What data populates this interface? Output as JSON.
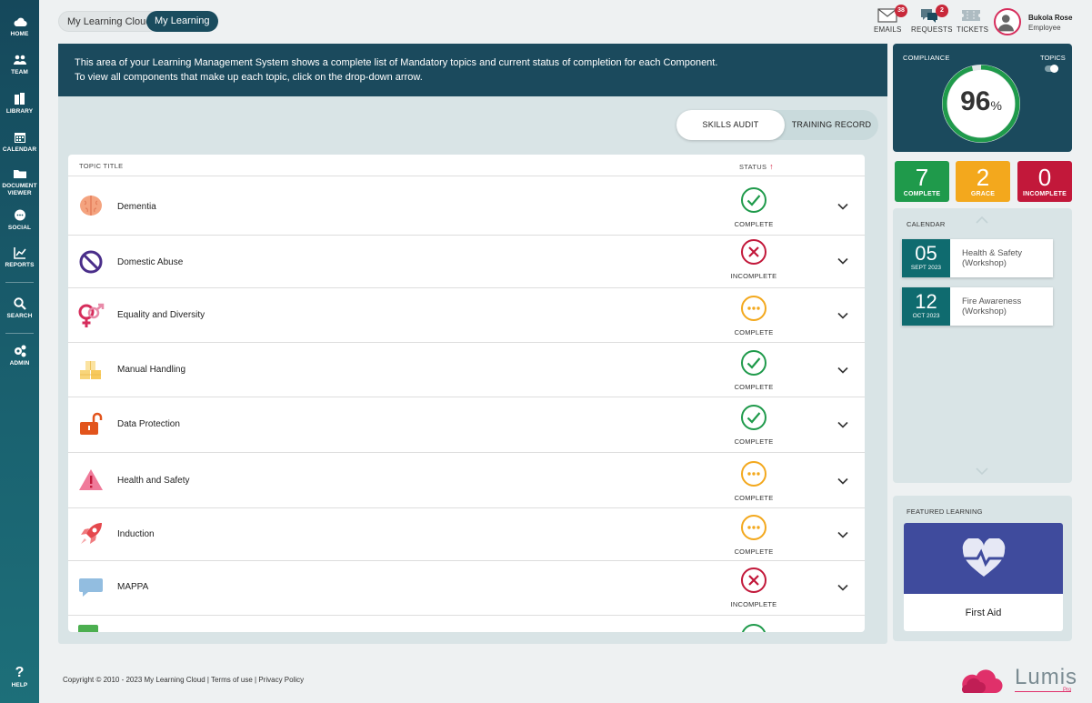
{
  "sidebar": {
    "items": [
      {
        "label": "HOME",
        "icon": "cloud-icon"
      },
      {
        "label": "TEAM",
        "icon": "team-icon"
      },
      {
        "label": "LIBRARY",
        "icon": "books-icon"
      },
      {
        "label": "CALENDAR",
        "icon": "calendar-icon"
      },
      {
        "label": "DOCUMENT",
        "label2": "VIEWER",
        "icon": "folder-icon"
      },
      {
        "label": "SOCIAL",
        "icon": "chat-icon"
      },
      {
        "label": "REPORTS",
        "icon": "chart-icon"
      },
      {
        "label": "SEARCH",
        "icon": "search-icon"
      },
      {
        "label": "ADMIN",
        "icon": "gears-icon"
      },
      {
        "label": "HELP",
        "icon": "help-icon"
      }
    ]
  },
  "breadcrumb": [
    "My Learning Cloud",
    "My Learning"
  ],
  "header": {
    "emails": {
      "label": "EMAILS",
      "count": "38"
    },
    "requests": {
      "label": "REQUESTS",
      "count": "2"
    },
    "tickets": {
      "label": "TICKETS"
    },
    "user": {
      "name": "Bukola Rose",
      "role": "Employee"
    }
  },
  "banner": {
    "line1": "This area of your Learning Management System shows a complete list of Mandatory topics and current status of completion for each Component.",
    "line2": "To view all components that make up each topic, click on the drop-down arrow."
  },
  "view_toggle": {
    "active": "SKILLS AUDIT",
    "inactive": "TRAINING RECORD"
  },
  "table": {
    "headers": {
      "title": "TOPIC TITLE",
      "status": "STATUS"
    },
    "rows": [
      {
        "title": "Dementia",
        "status": "COMPLETE",
        "state": "complete",
        "icon": "brain-icon"
      },
      {
        "title": "Domestic Abuse",
        "status": "INCOMPLETE",
        "state": "incomplete",
        "icon": "prohibited-icon"
      },
      {
        "title": "Equality and Diversity",
        "status": "COMPLETE",
        "state": "grace",
        "icon": "gender-icon"
      },
      {
        "title": "Manual Handling",
        "status": "COMPLETE",
        "state": "complete",
        "icon": "boxes-icon"
      },
      {
        "title": "Data Protection",
        "status": "COMPLETE",
        "state": "complete",
        "icon": "padlock-icon"
      },
      {
        "title": "Health and Safety",
        "status": "COMPLETE",
        "state": "grace",
        "icon": "warning-icon"
      },
      {
        "title": "Induction",
        "status": "COMPLETE",
        "state": "grace",
        "icon": "rocket-icon"
      },
      {
        "title": "MAPPA",
        "status": "INCOMPLETE",
        "state": "incomplete",
        "icon": "speech-bubble-icon"
      }
    ]
  },
  "compliance": {
    "label": "COMPLIANCE",
    "topics_label": "TOPICS",
    "value": "96",
    "unit": "%",
    "fraction": 0.96
  },
  "stats": [
    {
      "value": "7",
      "label": "COMPLETE",
      "color": "#1f9a4b"
    },
    {
      "value": "2",
      "label": "GRACE",
      "color": "#f3a81d"
    },
    {
      "value": "0",
      "label": "INCOMPLETE",
      "color": "#c2183a"
    }
  ],
  "calendar": {
    "label": "CALENDAR",
    "events": [
      {
        "day": "05",
        "month": "SEPT 2023",
        "title": "Health & Safety",
        "subtitle": "(Workshop)"
      },
      {
        "day": "12",
        "month": "OCT 2023",
        "title": "Fire Awareness",
        "subtitle": "(Workshop)"
      }
    ]
  },
  "featured": {
    "label": "FEATURED LEARNING",
    "title": "First Aid"
  },
  "footer": {
    "text": "Copyright © 2010 - 2023 My Learning Cloud | Terms of use | Privacy Policy"
  },
  "logo": {
    "name": "Lumis",
    "sub": "Pro"
  },
  "colors": {
    "navy": "#1b4a5d",
    "complete": "#1f9a4b",
    "grace": "#f3a81d",
    "incomplete": "#c2183a",
    "accent": "#e0306a"
  }
}
